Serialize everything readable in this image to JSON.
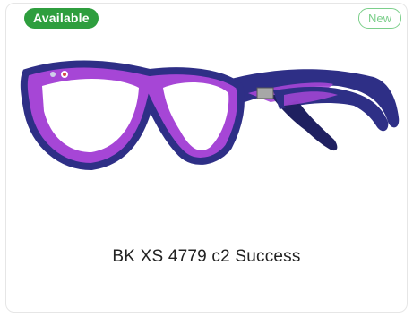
{
  "card": {
    "availability_badge": "Available",
    "new_badge": "New",
    "product_name": "BK XS 4779 c2 Success",
    "product_image_icon": "eyeglasses-frame",
    "colors": {
      "available_green": "#2e9e3e",
      "new_outline": "#7ccf8b",
      "frame_navy": "#2e2f86",
      "frame_purple": "#a646d6"
    }
  }
}
